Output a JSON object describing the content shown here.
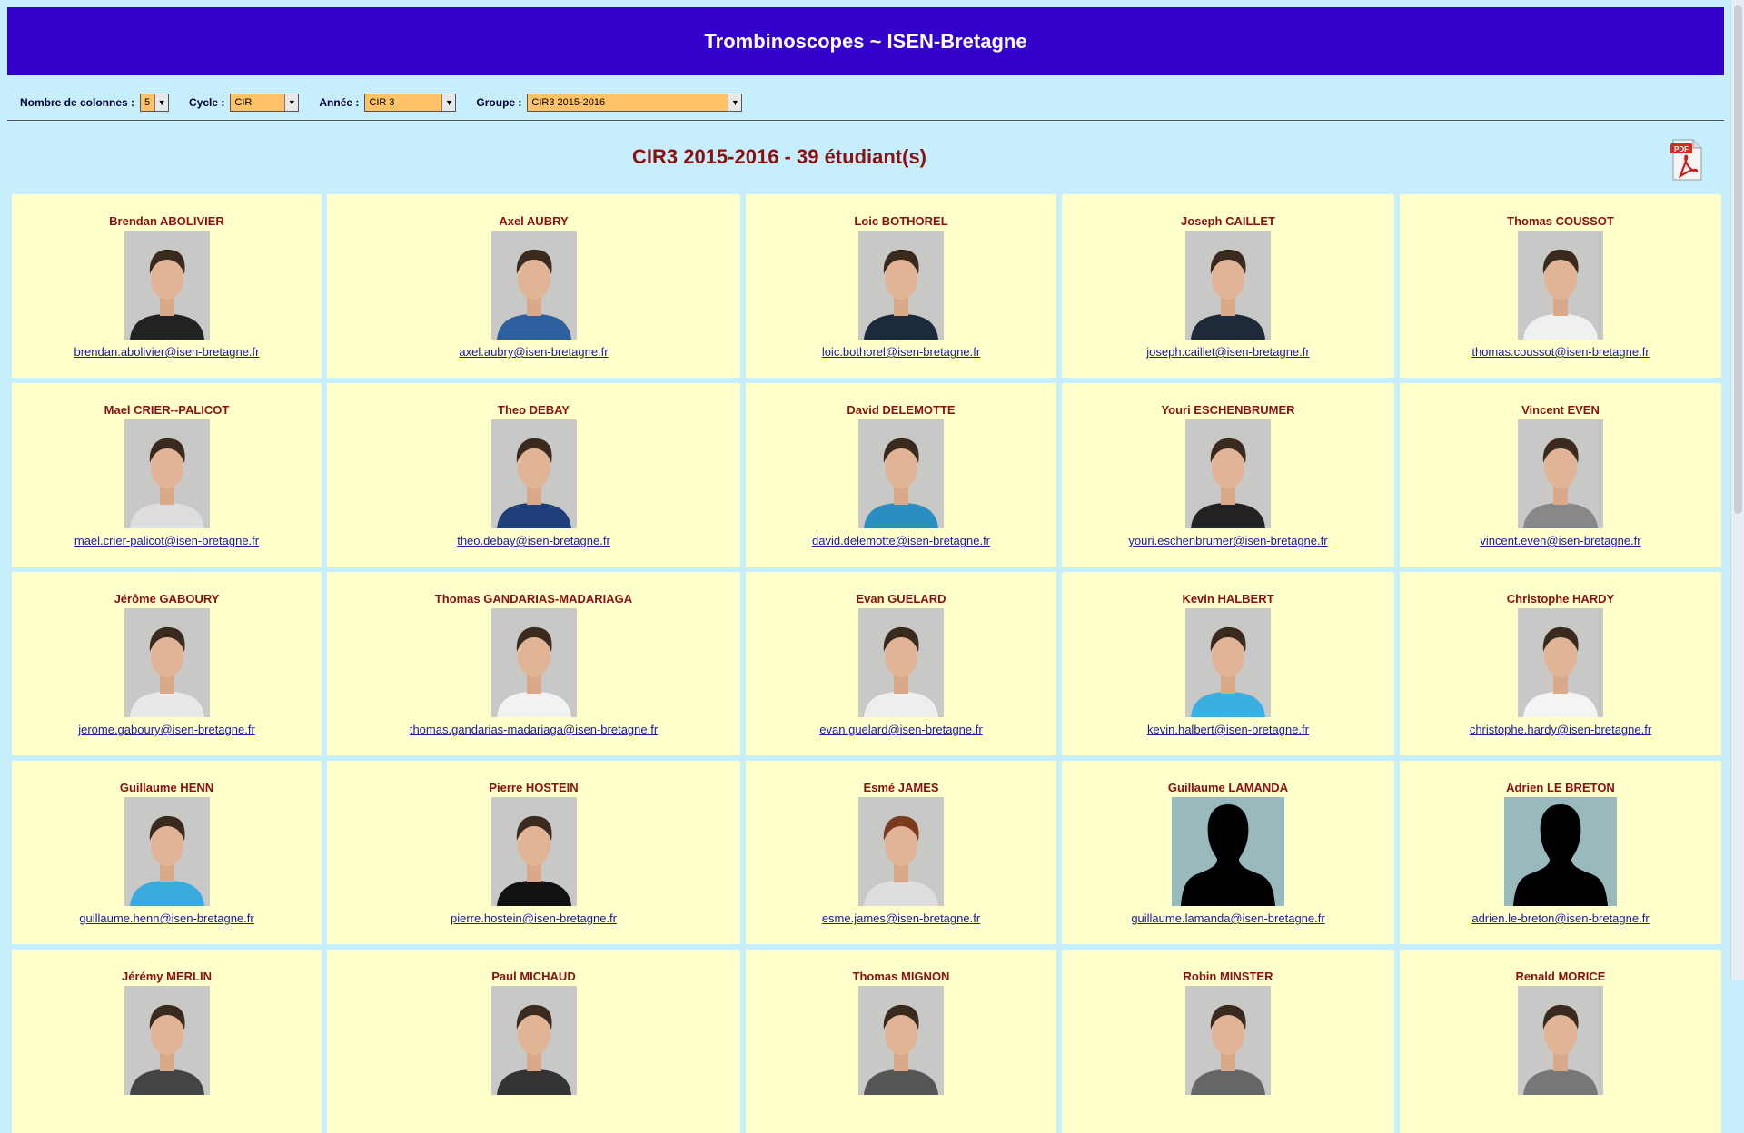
{
  "header": {
    "title": "Trombinoscopes ~ ISEN-Bretagne"
  },
  "filters": {
    "columns_label": "Nombre de colonnes :",
    "columns_value": "5",
    "cycle_label": "Cycle :",
    "cycle_value": "CIR",
    "year_label": "Année :",
    "year_value": "CIR 3",
    "group_label": "Groupe :",
    "group_value": "CIR3 2015-2016"
  },
  "group_title": "CIR3 2015-2016 - 39 étudiant(s)",
  "pdf_icon": "pdf-export-icon",
  "colors": {
    "header_bg": "#3300cc",
    "page_bg": "#c6eefc",
    "card_bg": "#ffffcc",
    "name_color": "#8b1010",
    "select_bg": "#ffc266"
  },
  "students": [
    {
      "name": "Brendan ABOLIVIER",
      "email": "brendan.abolivier@isen-bretagne.fr",
      "photo": "photo"
    },
    {
      "name": "Axel AUBRY",
      "email": "axel.aubry@isen-bretagne.fr",
      "photo": "photo"
    },
    {
      "name": "Loic BOTHOREL",
      "email": "loic.bothorel@isen-bretagne.fr",
      "photo": "photo"
    },
    {
      "name": "Joseph CAILLET",
      "email": "joseph.caillet@isen-bretagne.fr",
      "photo": "photo"
    },
    {
      "name": "Thomas COUSSOT",
      "email": "thomas.coussot@isen-bretagne.fr",
      "photo": "photo"
    },
    {
      "name": "Mael CRIER--PALICOT",
      "email": "mael.crier-palicot@isen-bretagne.fr",
      "photo": "photo"
    },
    {
      "name": "Theo DEBAY",
      "email": "theo.debay@isen-bretagne.fr",
      "photo": "photo"
    },
    {
      "name": "David DELEMOTTE",
      "email": "david.delemotte@isen-bretagne.fr",
      "photo": "photo"
    },
    {
      "name": "Youri ESCHENBRUMER",
      "email": "youri.eschenbrumer@isen-bretagne.fr",
      "photo": "photo"
    },
    {
      "name": "Vincent EVEN",
      "email": "vincent.even@isen-bretagne.fr",
      "photo": "photo"
    },
    {
      "name": "Jérôme GABOURY",
      "email": "jerome.gaboury@isen-bretagne.fr",
      "photo": "photo"
    },
    {
      "name": "Thomas GANDARIAS-MADARIAGA",
      "email": "thomas.gandarias-madariaga@isen-bretagne.fr",
      "photo": "photo"
    },
    {
      "name": "Evan GUELARD",
      "email": "evan.guelard@isen-bretagne.fr",
      "photo": "photo"
    },
    {
      "name": "Kevin HALBERT",
      "email": "kevin.halbert@isen-bretagne.fr",
      "photo": "photo"
    },
    {
      "name": "Christophe HARDY",
      "email": "christophe.hardy@isen-bretagne.fr",
      "photo": "photo"
    },
    {
      "name": "Guillaume HENN",
      "email": "guillaume.henn@isen-bretagne.fr",
      "photo": "photo"
    },
    {
      "name": "Pierre HOSTEIN",
      "email": "pierre.hostein@isen-bretagne.fr",
      "photo": "photo"
    },
    {
      "name": "Esmé JAMES",
      "email": "esme.james@isen-bretagne.fr",
      "photo": "photo"
    },
    {
      "name": "Guillaume LAMANDA",
      "email": "guillaume.lamanda@isen-bretagne.fr",
      "photo": "silhouette"
    },
    {
      "name": "Adrien LE BRETON",
      "email": "adrien.le-breton@isen-bretagne.fr",
      "photo": "silhouette"
    },
    {
      "name": "Jérémy MERLIN",
      "email": "",
      "photo": "photo"
    },
    {
      "name": "Paul MICHAUD",
      "email": "",
      "photo": "photo"
    },
    {
      "name": "Thomas MIGNON",
      "email": "",
      "photo": "photo"
    },
    {
      "name": "Robin MINSTER",
      "email": "",
      "photo": "photo"
    },
    {
      "name": "Renald MORICE",
      "email": "",
      "photo": "photo"
    }
  ]
}
